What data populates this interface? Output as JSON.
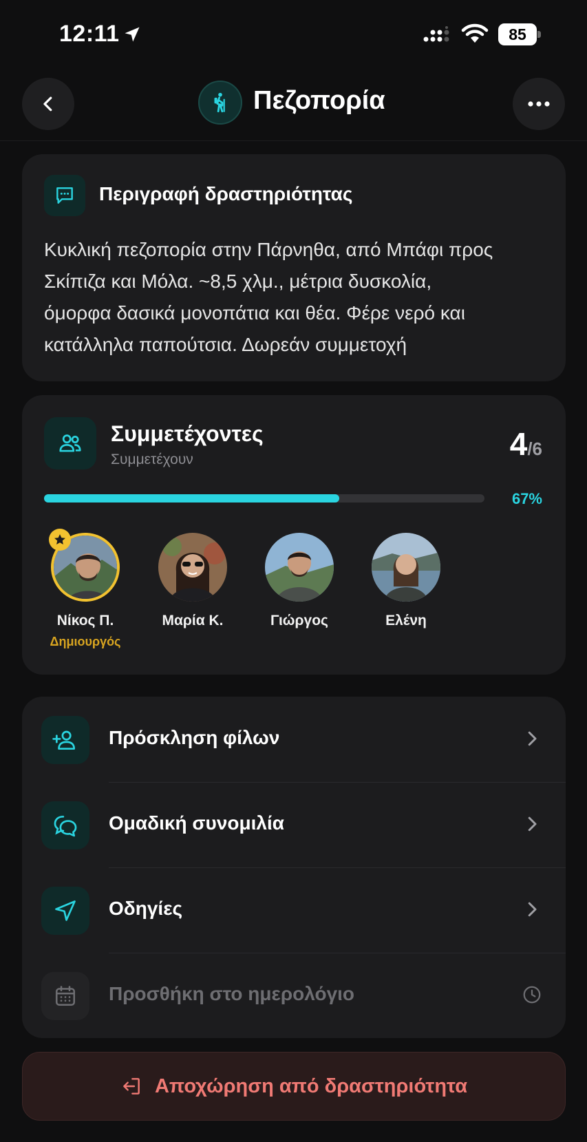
{
  "status_bar": {
    "time": "12:11",
    "battery": "85"
  },
  "header": {
    "title": "Πεζοπορία",
    "icons": [
      "back-chevron-icon",
      "hiking-icon",
      "more-dots-icon"
    ]
  },
  "description": {
    "title": "Περιγραφή δραστηριότητας",
    "lines": [
      "Κυκλική πεζοπορία στην Πάρνηθα, από Μπάφι προς",
      "Σκίπιζα και Μόλα. ~8,5 χλμ., μέτρια δυσκολία,",
      "όμορφα δασικά μονοπάτια και θέα. Φέρε νερό και",
      "κατάλληλα παπούτσια. Δωρεάν συμμετοχή"
    ]
  },
  "participants": {
    "title": "Συμμετέχοντες",
    "subtitle": "Συμμετέχουν",
    "count": "4",
    "total": "/6",
    "percent_label": "67%",
    "progress": 0.67,
    "members": [
      {
        "name": "Νίκος Π.",
        "role": "Δημιουργός",
        "host": true
      },
      {
        "name": "Μαρία Κ.",
        "role": "",
        "host": false
      },
      {
        "name": "Γιώργος",
        "role": "",
        "host": false
      },
      {
        "name": "Ελένη",
        "role": "",
        "host": false
      }
    ]
  },
  "actions": [
    {
      "label": "Πρόσκληση φίλων",
      "icon": "add-user-icon",
      "enabled": true
    },
    {
      "label": "Ομαδική συνομιλία",
      "icon": "chat-bubbles-icon",
      "enabled": true
    },
    {
      "label": "Οδηγίες",
      "icon": "navigation-arrow-icon",
      "enabled": true
    },
    {
      "label": "Προσθήκη στο ημερολόγιο",
      "icon": "calendar-icon",
      "enabled": false
    }
  ],
  "leave_button": {
    "label": "Αποχώρηση από δραστηριότητα"
  },
  "colors": {
    "accent": "#2ad4e0",
    "host": "#f2c230",
    "danger": "#f07a74",
    "card": "#1c1c1e",
    "background": "#0f0f10"
  }
}
